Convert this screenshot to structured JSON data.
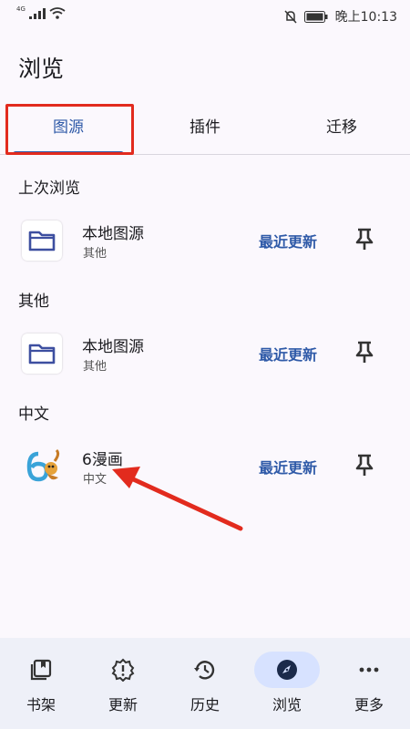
{
  "status_bar": {
    "network": "4G",
    "time": "晚上10:13"
  },
  "app": {
    "title": "浏览"
  },
  "tabs": [
    {
      "label": "图源",
      "active": true
    },
    {
      "label": "插件",
      "active": false
    },
    {
      "label": "迁移",
      "active": false
    }
  ],
  "sections": [
    {
      "header": "上次浏览",
      "items": [
        {
          "name": "本地图源",
          "lang": "其他",
          "action": "最近更新",
          "icon": "folder-icon"
        }
      ]
    },
    {
      "header": "其他",
      "items": [
        {
          "name": "本地图源",
          "lang": "其他",
          "action": "最近更新",
          "icon": "folder-icon"
        }
      ]
    },
    {
      "header": "中文",
      "items": [
        {
          "name": "6漫画",
          "lang": "中文",
          "action": "最近更新",
          "icon": "6manhua-logo"
        }
      ]
    }
  ],
  "bottom_nav": [
    {
      "label": "书架",
      "icon": "bookshelf-icon",
      "active": false
    },
    {
      "label": "更新",
      "icon": "alert-badge-icon",
      "active": false
    },
    {
      "label": "历史",
      "icon": "history-icon",
      "active": false
    },
    {
      "label": "浏览",
      "icon": "compass-icon",
      "active": true
    },
    {
      "label": "更多",
      "icon": "more-icon",
      "active": false
    }
  ],
  "colors": {
    "accent": "#2f5aa8",
    "annotation_red": "#e22b1e",
    "background": "#fbf8fd",
    "nav_background": "#eef0f8"
  }
}
